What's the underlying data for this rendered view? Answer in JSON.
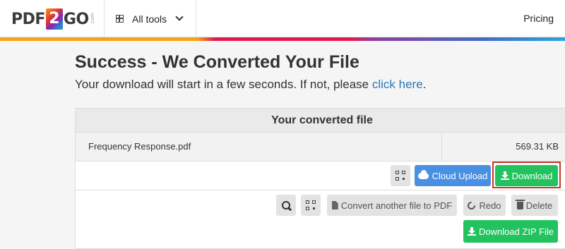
{
  "header": {
    "logo": {
      "part1": "PDF",
      "part2": "2",
      "part3": "GO",
      "suffix": ".com"
    },
    "all_tools_label": "All tools",
    "pricing_label": "Pricing"
  },
  "main": {
    "title": "Success - We Converted Your File",
    "subtitle_text": "Your download will start in a few seconds. If not, please ",
    "subtitle_link": "click here",
    "subtitle_end": "."
  },
  "panel": {
    "heading": "Your converted file",
    "file": {
      "name": "Frequency Response.pdf",
      "size": "569.31 KB"
    },
    "file_actions": {
      "cloud_upload_label": "Cloud Upload",
      "download_label": "Download"
    },
    "bottom_actions": {
      "convert_another_label": "Convert another file to PDF",
      "redo_label": "Redo",
      "delete_label": "Delete",
      "zip_label": "Download ZIP File"
    }
  },
  "colors": {
    "accent_green": "#22c35e",
    "accent_blue": "#4a90e2",
    "link": "#2a7ab8",
    "highlight": "#c0392b"
  }
}
